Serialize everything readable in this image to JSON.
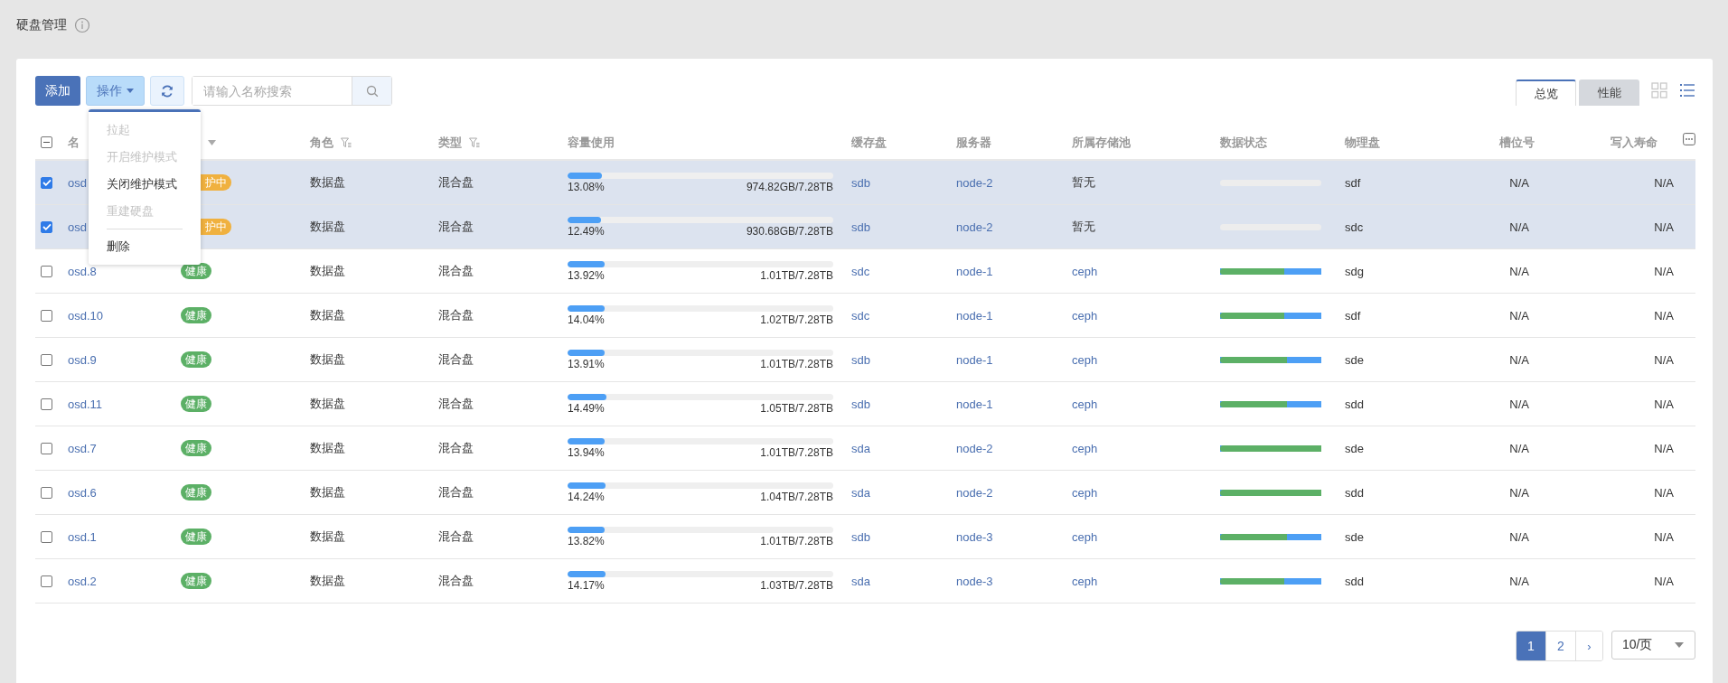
{
  "page": {
    "title": "硬盘管理"
  },
  "toolbar": {
    "add": "添加",
    "actions": "操作",
    "search": {
      "placeholder": "请输入名称搜索"
    }
  },
  "menu": {
    "items": [
      {
        "label": "拉起",
        "disabled": true
      },
      {
        "label": "开启维护模式",
        "disabled": true
      },
      {
        "label": "关闭维护模式",
        "disabled": false
      },
      {
        "label": "重建硬盘",
        "disabled": true
      },
      {
        "label": "删除",
        "disabled": false,
        "separator_before": true
      }
    ]
  },
  "view_tabs": [
    {
      "label": "总览",
      "selected": true
    },
    {
      "label": "性能",
      "selected": false
    }
  ],
  "view_modes": [
    {
      "kind": "grid",
      "selected": false
    },
    {
      "kind": "list",
      "selected": true
    }
  ],
  "table": {
    "columns": [
      {
        "label": "名",
        "kind": "covered"
      },
      {
        "kind": "sort"
      },
      {
        "label": "角色",
        "kind": "filter"
      },
      {
        "label": "类型",
        "kind": "filter"
      },
      {
        "label": "容量使用",
        "kind": "plain"
      },
      {
        "label": "缓存盘",
        "kind": "plain"
      },
      {
        "label": "服务器",
        "kind": "plain"
      },
      {
        "label": "所属存储池",
        "kind": "plain"
      },
      {
        "label": "数据状态",
        "kind": "plain"
      },
      {
        "label": "物理盘",
        "kind": "plain"
      },
      {
        "label": "槽位号",
        "kind": "right"
      },
      {
        "label": "写入寿命",
        "kind": "right"
      }
    ],
    "select_all": {
      "indeterminate": true
    },
    "rows": [
      {
        "selected": true,
        "name": "osd",
        "status": {
          "label": "护中",
          "kind": "maintenance"
        },
        "role": "数据盘",
        "type": "混合盘",
        "capacity": {
          "level": 0.1308,
          "percent": "13.08%",
          "used": "974.82GB/7.28TB"
        },
        "cache": "sdb",
        "server": "node-2",
        "pool": {
          "label": "暂无",
          "link": false
        },
        "data_state": {
          "shown": false
        },
        "disk": "sdf",
        "slot": "N/A",
        "life": "N/A"
      },
      {
        "selected": true,
        "name": "osd",
        "status": {
          "label": "护中",
          "kind": "maintenance"
        },
        "role": "数据盘",
        "type": "混合盘",
        "capacity": {
          "level": 0.1249,
          "percent": "12.49%",
          "used": "930.68GB/7.28TB"
        },
        "cache": "sdb",
        "server": "node-2",
        "pool": {
          "label": "暂无",
          "link": false
        },
        "data_state": {
          "shown": false
        },
        "disk": "sdc",
        "slot": "N/A",
        "life": "N/A"
      },
      {
        "selected": false,
        "name": "osd.8",
        "status": {
          "label": "健康",
          "kind": "healthy"
        },
        "role": "数据盘",
        "type": "混合盘",
        "capacity": {
          "level": 0.1392,
          "percent": "13.92%",
          "used": "1.01TB/7.28TB"
        },
        "cache": "sdc",
        "server": "node-1",
        "pool": {
          "label": "ceph",
          "link": true
        },
        "data_state": {
          "shown": true,
          "level": 0.63
        },
        "disk": "sdg",
        "slot": "N/A",
        "life": "N/A"
      },
      {
        "selected": false,
        "name": "osd.10",
        "status": {
          "label": "健康",
          "kind": "healthy"
        },
        "role": "数据盘",
        "type": "混合盘",
        "capacity": {
          "level": 0.1404,
          "percent": "14.04%",
          "used": "1.02TB/7.28TB"
        },
        "cache": "sdc",
        "server": "node-1",
        "pool": {
          "label": "ceph",
          "link": true
        },
        "data_state": {
          "shown": true,
          "level": 0.63
        },
        "disk": "sdf",
        "slot": "N/A",
        "life": "N/A"
      },
      {
        "selected": false,
        "name": "osd.9",
        "status": {
          "label": "健康",
          "kind": "healthy"
        },
        "role": "数据盘",
        "type": "混合盘",
        "capacity": {
          "level": 0.1391,
          "percent": "13.91%",
          "used": "1.01TB/7.28TB"
        },
        "cache": "sdb",
        "server": "node-1",
        "pool": {
          "label": "ceph",
          "link": true
        },
        "data_state": {
          "shown": true,
          "level": 0.66
        },
        "disk": "sde",
        "slot": "N/A",
        "life": "N/A"
      },
      {
        "selected": false,
        "name": "osd.11",
        "status": {
          "label": "健康",
          "kind": "healthy"
        },
        "role": "数据盘",
        "type": "混合盘",
        "capacity": {
          "level": 0.1449,
          "percent": "14.49%",
          "used": "1.05TB/7.28TB"
        },
        "cache": "sdb",
        "server": "node-1",
        "pool": {
          "label": "ceph",
          "link": true
        },
        "data_state": {
          "shown": true,
          "level": 0.66
        },
        "disk": "sdd",
        "slot": "N/A",
        "life": "N/A"
      },
      {
        "selected": false,
        "name": "osd.7",
        "status": {
          "label": "健康",
          "kind": "healthy"
        },
        "role": "数据盘",
        "type": "混合盘",
        "capacity": {
          "level": 0.1394,
          "percent": "13.94%",
          "used": "1.01TB/7.28TB"
        },
        "cache": "sda",
        "server": "node-2",
        "pool": {
          "label": "ceph",
          "link": true
        },
        "data_state": {
          "shown": true,
          "level": 1
        },
        "disk": "sde",
        "slot": "N/A",
        "life": "N/A"
      },
      {
        "selected": false,
        "name": "osd.6",
        "status": {
          "label": "健康",
          "kind": "healthy"
        },
        "role": "数据盘",
        "type": "混合盘",
        "capacity": {
          "level": 0.1424,
          "percent": "14.24%",
          "used": "1.04TB/7.28TB"
        },
        "cache": "sda",
        "server": "node-2",
        "pool": {
          "label": "ceph",
          "link": true
        },
        "data_state": {
          "shown": true,
          "level": 1
        },
        "disk": "sdd",
        "slot": "N/A",
        "life": "N/A"
      },
      {
        "selected": false,
        "name": "osd.1",
        "status": {
          "label": "健康",
          "kind": "healthy"
        },
        "role": "数据盘",
        "type": "混合盘",
        "capacity": {
          "level": 0.1382,
          "percent": "13.82%",
          "used": "1.01TB/7.28TB"
        },
        "cache": "sdb",
        "server": "node-3",
        "pool": {
          "label": "ceph",
          "link": true
        },
        "data_state": {
          "shown": true,
          "level": 0.66
        },
        "disk": "sde",
        "slot": "N/A",
        "life": "N/A"
      },
      {
        "selected": false,
        "name": "osd.2",
        "status": {
          "label": "健康",
          "kind": "healthy"
        },
        "role": "数据盘",
        "type": "混合盘",
        "capacity": {
          "level": 0.1417,
          "percent": "14.17%",
          "used": "1.03TB/7.28TB"
        },
        "cache": "sda",
        "server": "node-3",
        "pool": {
          "label": "ceph",
          "link": true
        },
        "data_state": {
          "shown": true,
          "level": 0.63
        },
        "disk": "sdd",
        "slot": "N/A",
        "life": "N/A"
      }
    ]
  },
  "pagination": {
    "pages": [
      {
        "label": "1",
        "selected": true
      },
      {
        "label": "2",
        "selected": false
      }
    ],
    "next": "›",
    "page_size": "10/页"
  }
}
